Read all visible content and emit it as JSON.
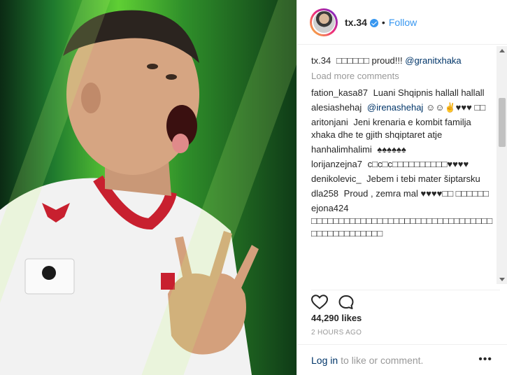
{
  "post": {
    "username": "tx.34",
    "follow_label": "Follow",
    "separator": "•"
  },
  "caption": {
    "user": "tx.34",
    "text": "□□□□□□ proud!!!",
    "mention": "@granitxhaka"
  },
  "load_more": "Load more comments",
  "comments": [
    {
      "user": "fation_kasa87",
      "text": "Luani Shqipnis hallall hallall",
      "mention": ""
    },
    {
      "user": "alesiashehaj",
      "text": "☺☺✌♥♥♥ □□",
      "mention": "@irenashehaj"
    },
    {
      "user": "aritonjani",
      "text": "Jeni krenaria e kombit familja xhaka dhe te gjith shqiptaret atje",
      "mention": ""
    },
    {
      "user": "hanhalimhalimi",
      "text": "♠♠♠♠♠♠",
      "mention": ""
    },
    {
      "user": "lorijanzejna7",
      "text": "c□c□c□□□□□□□□□□♥♥♥♥",
      "mention": ""
    },
    {
      "user": "denikolevic_",
      "text": "Jebem i tebi mater šiptarsku",
      "mention": ""
    },
    {
      "user": "dla258",
      "text": "Proud , zemra mal ♥♥♥♥□□ □□□□□□",
      "mention": ""
    },
    {
      "user": "ejona424",
      "text": "□□□□□□□□□□□□□□□□□□□□□□□□□□□□□□□□□□□□□□□□□□□□□□",
      "mention": ""
    }
  ],
  "likes": "44,290 likes",
  "time": "2 HOURS AGO",
  "footer": {
    "login": "Log in",
    "rest": "to like or comment."
  },
  "icons": {
    "like": "heart-icon",
    "comment": "comment-icon",
    "more": "more-options-icon"
  }
}
